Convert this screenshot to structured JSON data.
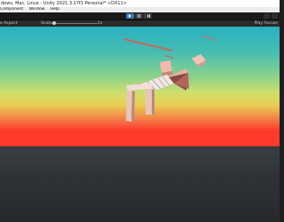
{
  "window": {
    "title": "dows, Mac, Linux - Unity 2021.3.17f1 Personal* <DX11>"
  },
  "menu": {
    "items": [
      "Component",
      "Window",
      "Help"
    ]
  },
  "toolbar": {
    "play_icon": "play-icon",
    "pause_icon": "pause-icon",
    "step_icon": "step-icon",
    "active_color": "#3a78c4"
  },
  "game_view": {
    "aspect_label": "e Aspect",
    "scale_label": "Scale",
    "scale_value": "1x",
    "play_focused_label": "Play Focuse"
  },
  "viewport": {
    "sky_top_color": "#2ab1c2",
    "horizon_color": "#ff3a2c",
    "ground_color": "#2e3236"
  }
}
